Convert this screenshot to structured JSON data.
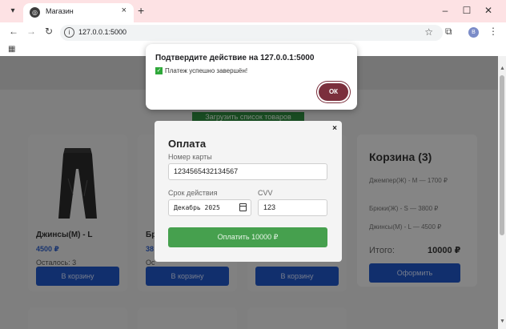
{
  "browser": {
    "tab_title": "Магазин",
    "new_tab_symbol": "+",
    "tab_close_symbol": "×",
    "url": "127.0.0.1:5000",
    "profile_initial": "B",
    "window_controls": {
      "minimize": "–",
      "maximize": "☐",
      "close": "✕"
    }
  },
  "shop": {
    "load_button": "Загрузить список товаров",
    "products": [
      {
        "name": "Джинсы(М) - L",
        "price": "4500 ₽",
        "stock": "Осталось: 3",
        "button": "В корзину",
        "icon": "jeans-image"
      },
      {
        "name": "Бр",
        "price": "38",
        "stock": "Ос",
        "button": "В корзину",
        "icon": "product-image"
      },
      {
        "name": "",
        "price": "",
        "stock": "",
        "button": "В корзину",
        "icon": "product-image"
      }
    ],
    "cart": {
      "title": "Корзина (3)",
      "items": [
        "Джемпер(Ж) - M — 1700 ₽",
        "Брюки(Ж) - S — 3800 ₽",
        "Джинсы(М) - L — 4500 ₽"
      ],
      "total_label": "Итого:",
      "total_value": "10000 ₽",
      "checkout_button": "Оформить"
    }
  },
  "payment_modal": {
    "close_symbol": "×",
    "title": "Оплата",
    "card_label": "Номер карты",
    "card_value": "1234565432134567",
    "expiry_label": "Срок действия",
    "expiry_value": "Декабрь 2025",
    "cvv_label": "CVV",
    "cvv_value": "123",
    "pay_button": "Оплатить 10000 ₽"
  },
  "confirm_dialog": {
    "title": "Подтвердите действие на 127.0.0.1:5000",
    "message": "Платеж успешно завершён!",
    "ok_button": "ОК"
  },
  "colors": {
    "tabstrip": "#fde2e4",
    "primary_blue": "#1f56c7",
    "pay_green": "#46a04e",
    "ok_button": "#7b2f3c"
  }
}
